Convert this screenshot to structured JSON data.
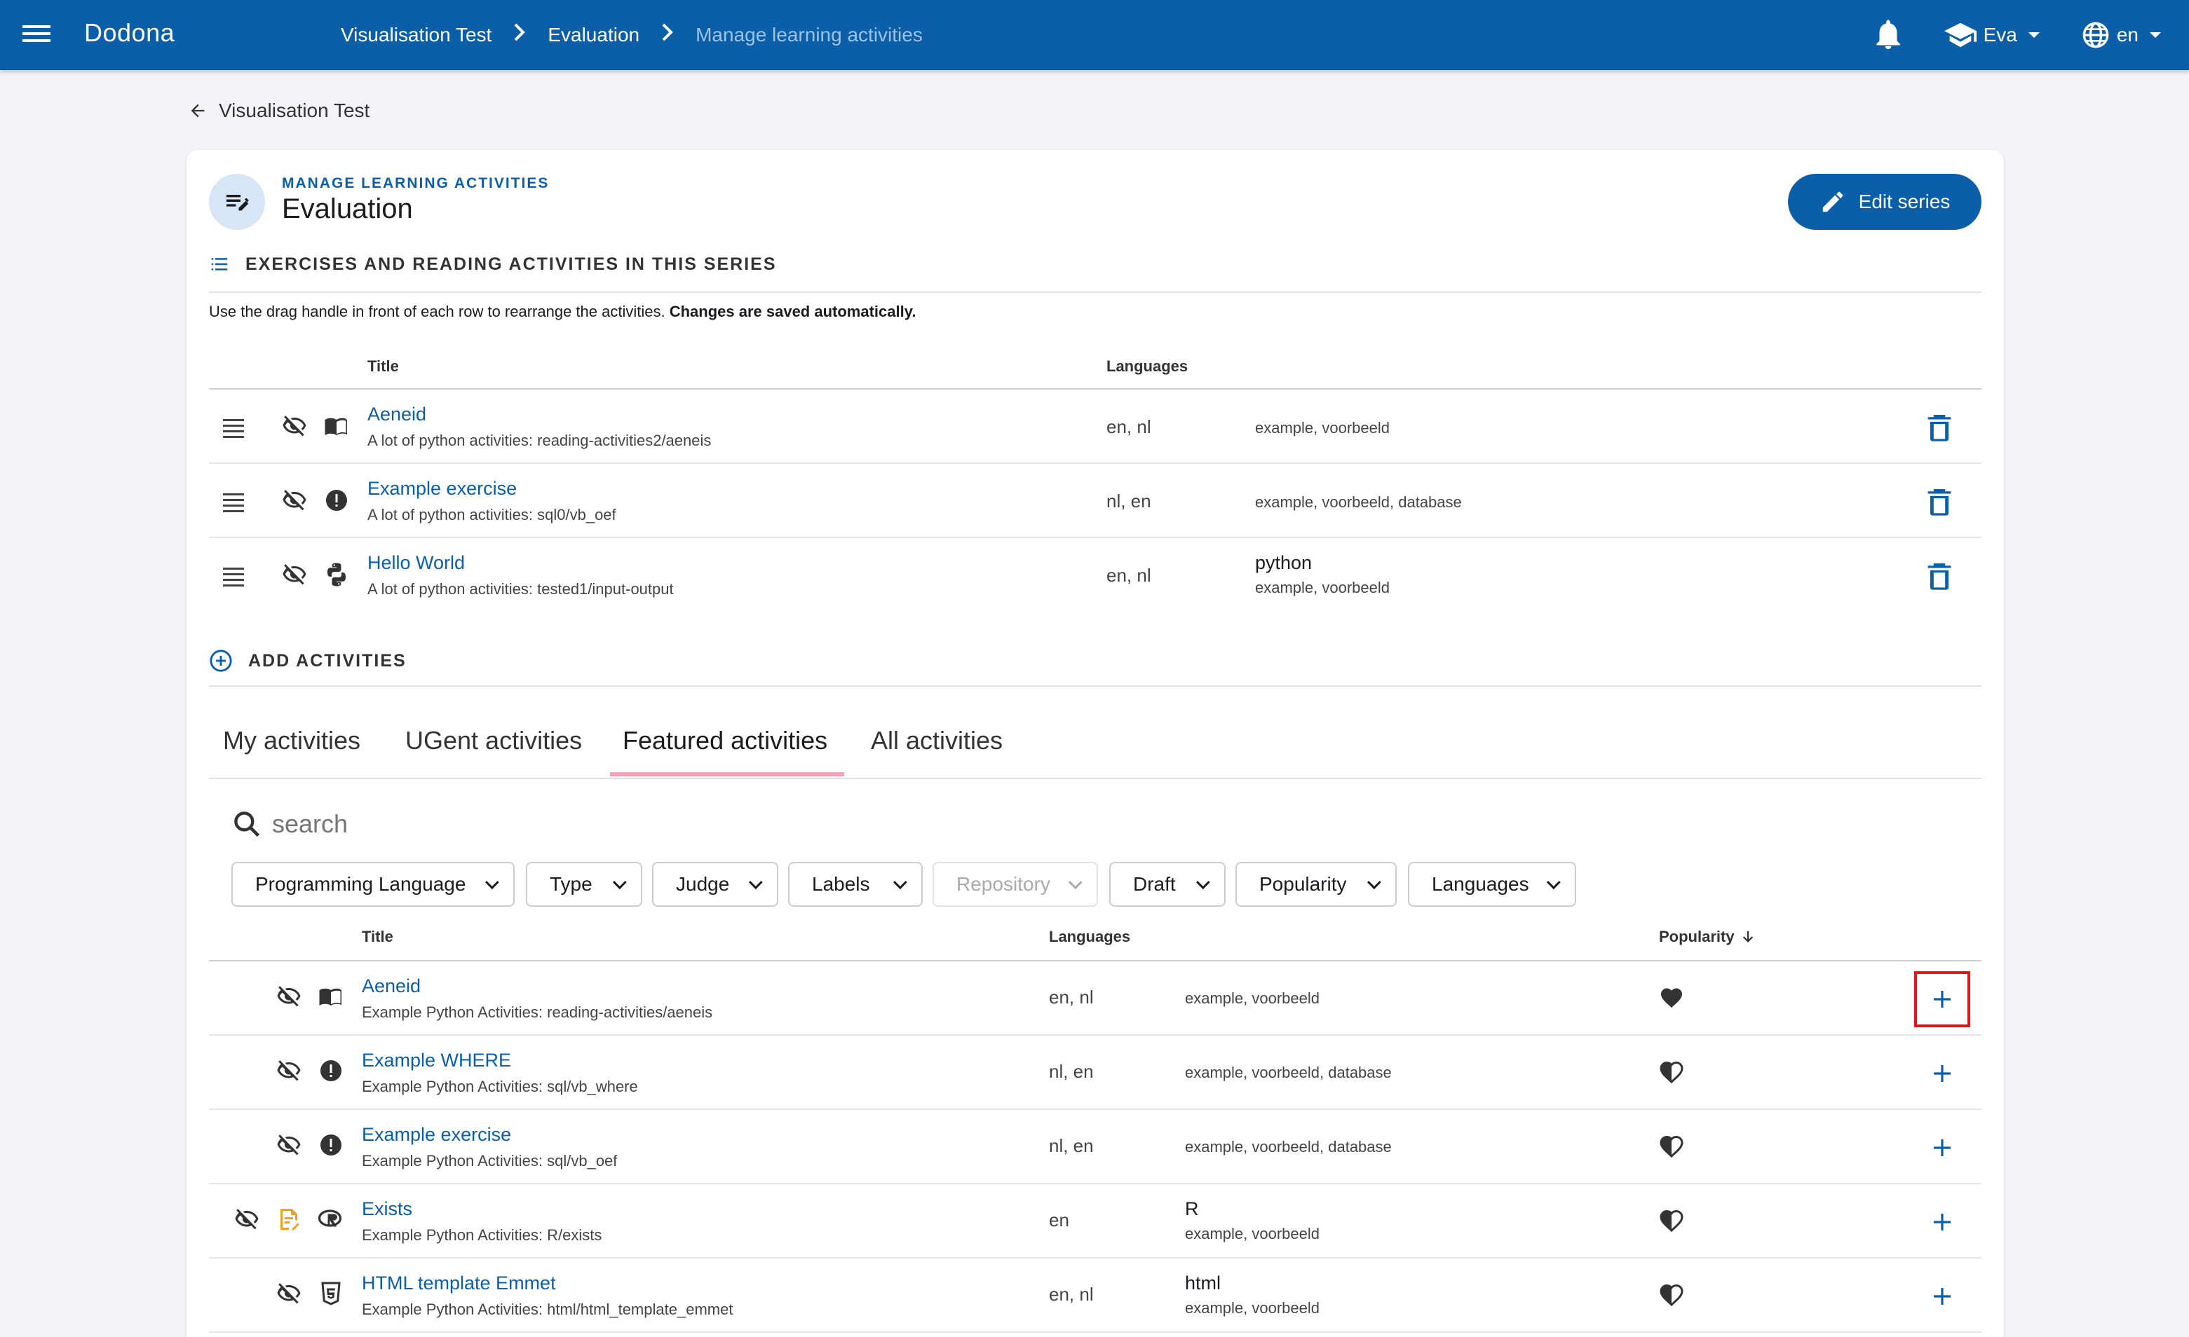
{
  "topbar": {
    "brand": "Dodona",
    "breadcrumbs": [
      "Visualisation Test",
      "Evaluation",
      "Manage learning activities"
    ],
    "user": "Eva",
    "language": "en"
  },
  "back_label": "Visualisation Test",
  "card": {
    "overline": "MANAGE LEARNING ACTIVITIES",
    "title": "Evaluation",
    "edit_button": "Edit series"
  },
  "series_section": {
    "heading": "EXERCISES AND READING ACTIVITIES IN THIS SERIES",
    "hint_normal": "Use the drag handle in front of each row to rearrange the activities. ",
    "hint_bold": "Changes are saved automatically.",
    "col_title": "Title",
    "col_languages": "Languages",
    "rows": [
      {
        "title": "Aeneid",
        "sub": "A lot of python activities: reading-activities2/aeneis",
        "langs": "en, nl",
        "prog": "",
        "labels": "example, voorbeeld",
        "type_icon": "book-icon"
      },
      {
        "title": "Example exercise",
        "sub": "A lot of python activities: sql0/vb_oef",
        "langs": "nl, en",
        "prog": "",
        "labels": "example, voorbeeld, database",
        "type_icon": "alert-circle-icon"
      },
      {
        "title": "Hello World",
        "sub": "A lot of python activities: tested1/input-output",
        "langs": "en, nl",
        "prog": "python",
        "labels": "example, voorbeeld",
        "type_icon": "python-icon"
      }
    ]
  },
  "add_section": {
    "heading": "ADD ACTIVITIES",
    "tabs": [
      "My activities",
      "UGent activities",
      "Featured activities",
      "All activities"
    ],
    "active_tab": 2,
    "search_placeholder": "search",
    "filters": [
      "Programming Language",
      "Type",
      "Judge",
      "Labels",
      "Repository",
      "Draft",
      "Popularity",
      "Languages"
    ],
    "col_title": "Title",
    "col_languages": "Languages",
    "col_popularity": "Popularity",
    "rows": [
      {
        "title": "Aeneid",
        "sub": "Example Python Activities: reading-activities/aeneis",
        "langs": "en, nl",
        "prog": "",
        "labels": "example, voorbeeld",
        "popularity": "full-heart"
      },
      {
        "title": "Example WHERE",
        "sub": "Example Python Activities: sql/vb_where",
        "langs": "nl, en",
        "prog": "",
        "labels": "example, voorbeeld, database",
        "popularity": "half-heart"
      },
      {
        "title": "Example exercise",
        "sub": "Example Python Activities: sql/vb_oef",
        "langs": "nl, en",
        "prog": "",
        "labels": "example, voorbeeld, database",
        "popularity": "half-heart"
      },
      {
        "title": "Exists",
        "sub": "Example Python Activities: R/exists",
        "langs": "en",
        "prog": "R",
        "labels": "example, voorbeeld",
        "popularity": "half-heart"
      },
      {
        "title": "HTML template Emmet",
        "sub": "Example Python Activities: html/html_template_emmet",
        "langs": "en, nl",
        "prog": "html",
        "labels": "example, voorbeeld",
        "popularity": "half-heart"
      }
    ]
  },
  "colors": {
    "primary": "#0a5fa8",
    "tab_indicator": "#f2a2b8",
    "highlight": "#e3141b",
    "draft_orange": "#f0a020"
  }
}
